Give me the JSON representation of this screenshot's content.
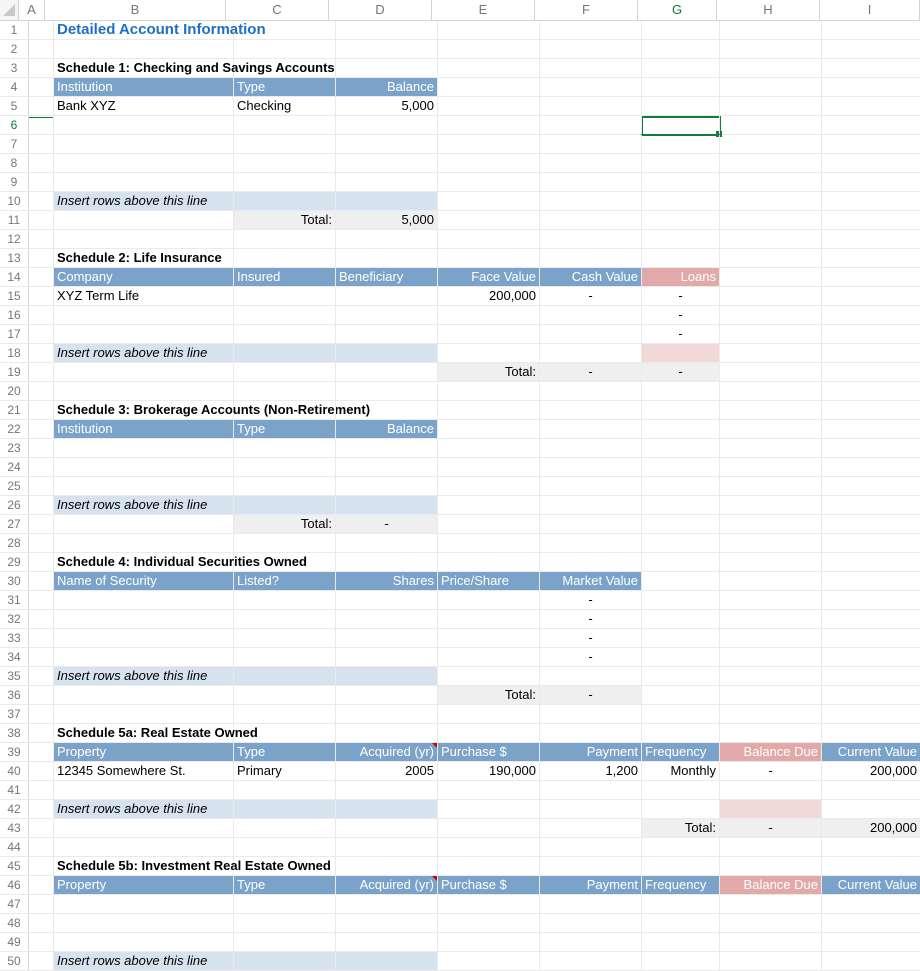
{
  "columns": [
    "A",
    "B",
    "C",
    "D",
    "E",
    "F",
    "G",
    "H",
    "I"
  ],
  "selectedColumn": "G",
  "selectedRow": 6,
  "title": "Detailed Account Information",
  "schedule1": {
    "title": "Schedule 1: Checking and Savings Accounts",
    "headers": {
      "institution": "Institution",
      "type": "Type",
      "balance": "Balance"
    },
    "row": {
      "institution": "Bank XYZ",
      "type": "Checking",
      "balance": "5,000"
    },
    "insert": "Insert rows above this line",
    "totalLabel": "Total:",
    "totalValue": "5,000"
  },
  "schedule2": {
    "title": "Schedule 2: Life Insurance",
    "headers": {
      "company": "Company",
      "insured": "Insured",
      "beneficiary": "Beneficiary",
      "face": "Face Value",
      "cash": "Cash Value",
      "loans": "Loans"
    },
    "row": {
      "company": "XYZ Term Life",
      "insured": "",
      "beneficiary": "",
      "face": "200,000",
      "cash": "-",
      "loans": "-"
    },
    "dash": "-",
    "insert": "Insert rows above this line",
    "totalLabel": "Total:",
    "totalCash": "-",
    "totalLoans": "-"
  },
  "schedule3": {
    "title": "Schedule 3: Brokerage Accounts (Non-Retirement)",
    "headers": {
      "institution": "Institution",
      "type": "Type",
      "balance": "Balance"
    },
    "insert": "Insert rows above this line",
    "totalLabel": "Total:",
    "totalValue": "-"
  },
  "schedule4": {
    "title": "Schedule 4: Individual Securities Owned",
    "headers": {
      "name": "Name of Security",
      "listed": "Listed?",
      "shares": "Shares",
      "price": "Price/Share",
      "market": "Market Value"
    },
    "dash": "-",
    "insert": "Insert rows above this line",
    "totalLabel": "Total:",
    "totalValue": "-"
  },
  "schedule5a": {
    "title": "Schedule 5a: Real Estate Owned",
    "headers": {
      "property": "Property",
      "type": "Type",
      "acquired": "Acquired (yr)",
      "purchase": "Purchase $",
      "payment": "Payment",
      "freq": "Frequency",
      "balance": "Balance Due",
      "current": "Current Value"
    },
    "row": {
      "property": "12345 Somewhere St.",
      "type": "Primary",
      "acquired": "2005",
      "purchase": "190,000",
      "payment": "1,200",
      "freq": "Monthly",
      "balance": "-",
      "current": "200,000"
    },
    "insert": "Insert rows above this line",
    "totalLabel": "Total:",
    "totalBalance": "-",
    "totalCurrent": "200,000"
  },
  "schedule5b": {
    "title": "Schedule 5b: Investment Real Estate Owned",
    "headers": {
      "property": "Property",
      "type": "Type",
      "acquired": "Acquired (yr)",
      "purchase": "Purchase $",
      "payment": "Payment",
      "freq": "Frequency",
      "balance": "Balance Due",
      "current": "Current Value"
    },
    "insert": "Insert rows above this line"
  }
}
